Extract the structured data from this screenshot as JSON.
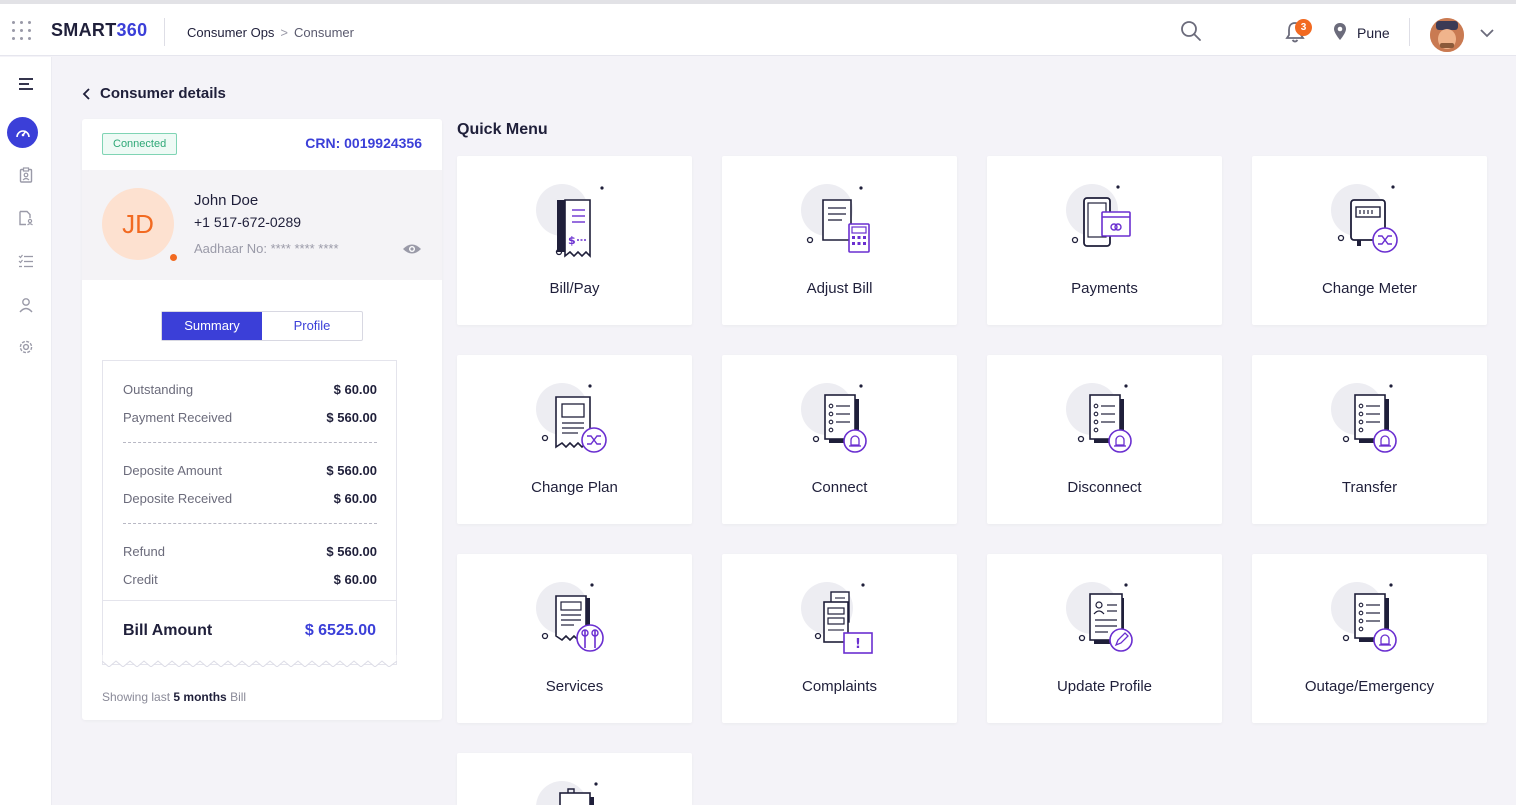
{
  "app": {
    "logo_main": "SMART",
    "logo_num": "360"
  },
  "breadcrumb": {
    "parent": "Consumer Ops",
    "separator": ">",
    "current": "Consumer"
  },
  "header": {
    "notification_count": "3",
    "location": "Pune"
  },
  "sidebar": {
    "items": [
      "menu-icon",
      "dashboard-icon",
      "clipboard-icon",
      "document-user-icon",
      "checklist-icon",
      "user-icon",
      "gear-icon"
    ]
  },
  "page": {
    "title": "Consumer details",
    "quick_menu_title": "Quick Menu"
  },
  "consumer": {
    "status": "Connected",
    "crn": "CRN: 0019924356",
    "initials": "JD",
    "name": "John Doe",
    "phone": "+1 517-672-0289",
    "aadhaar": "Aadhaar No: **** **** ****"
  },
  "tabs": {
    "summary": "Summary",
    "profile": "Profile"
  },
  "summary": {
    "outstanding_label": "Outstanding",
    "outstanding_value": "$ 60.00",
    "payment_received_label": "Payment Received",
    "payment_received_value": "$ 560.00",
    "deposite_amount_label": "Deposite Amount",
    "deposite_amount_value": "$ 560.00",
    "deposite_received_label": "Deposite Received",
    "deposite_received_value": "$ 60.00",
    "refund_label": "Refund",
    "refund_value": "$ 560.00",
    "credit_label": "Credit",
    "credit_value": "$ 60.00",
    "bill_amount_label": "Bill Amount",
    "bill_amount_value": "$ 6525.00",
    "showing_prefix": "Showing last",
    "showing_bold": "5 months",
    "showing_suffix": "Bill"
  },
  "quick_menu": [
    {
      "label": "Bill/Pay",
      "icon": "bill-pay-icon"
    },
    {
      "label": "Adjust Bill",
      "icon": "adjust-bill-icon"
    },
    {
      "label": "Payments",
      "icon": "payments-icon"
    },
    {
      "label": "Change Meter",
      "icon": "change-meter-icon"
    },
    {
      "label": "Change Plan",
      "icon": "change-plan-icon"
    },
    {
      "label": "Connect",
      "icon": "connect-icon"
    },
    {
      "label": "Disconnect",
      "icon": "disconnect-icon"
    },
    {
      "label": "Transfer",
      "icon": "transfer-icon"
    },
    {
      "label": "Services",
      "icon": "services-icon"
    },
    {
      "label": "Complaints",
      "icon": "complaints-icon"
    },
    {
      "label": "Update Profile",
      "icon": "update-profile-icon"
    },
    {
      "label": "Outage/Emergency",
      "icon": "outage-emergency-icon"
    },
    {
      "label": "",
      "icon": "more-icon"
    }
  ],
  "colors": {
    "accent": "#3b3fd8",
    "orange": "#f26a21",
    "connected": "#2fa877"
  }
}
